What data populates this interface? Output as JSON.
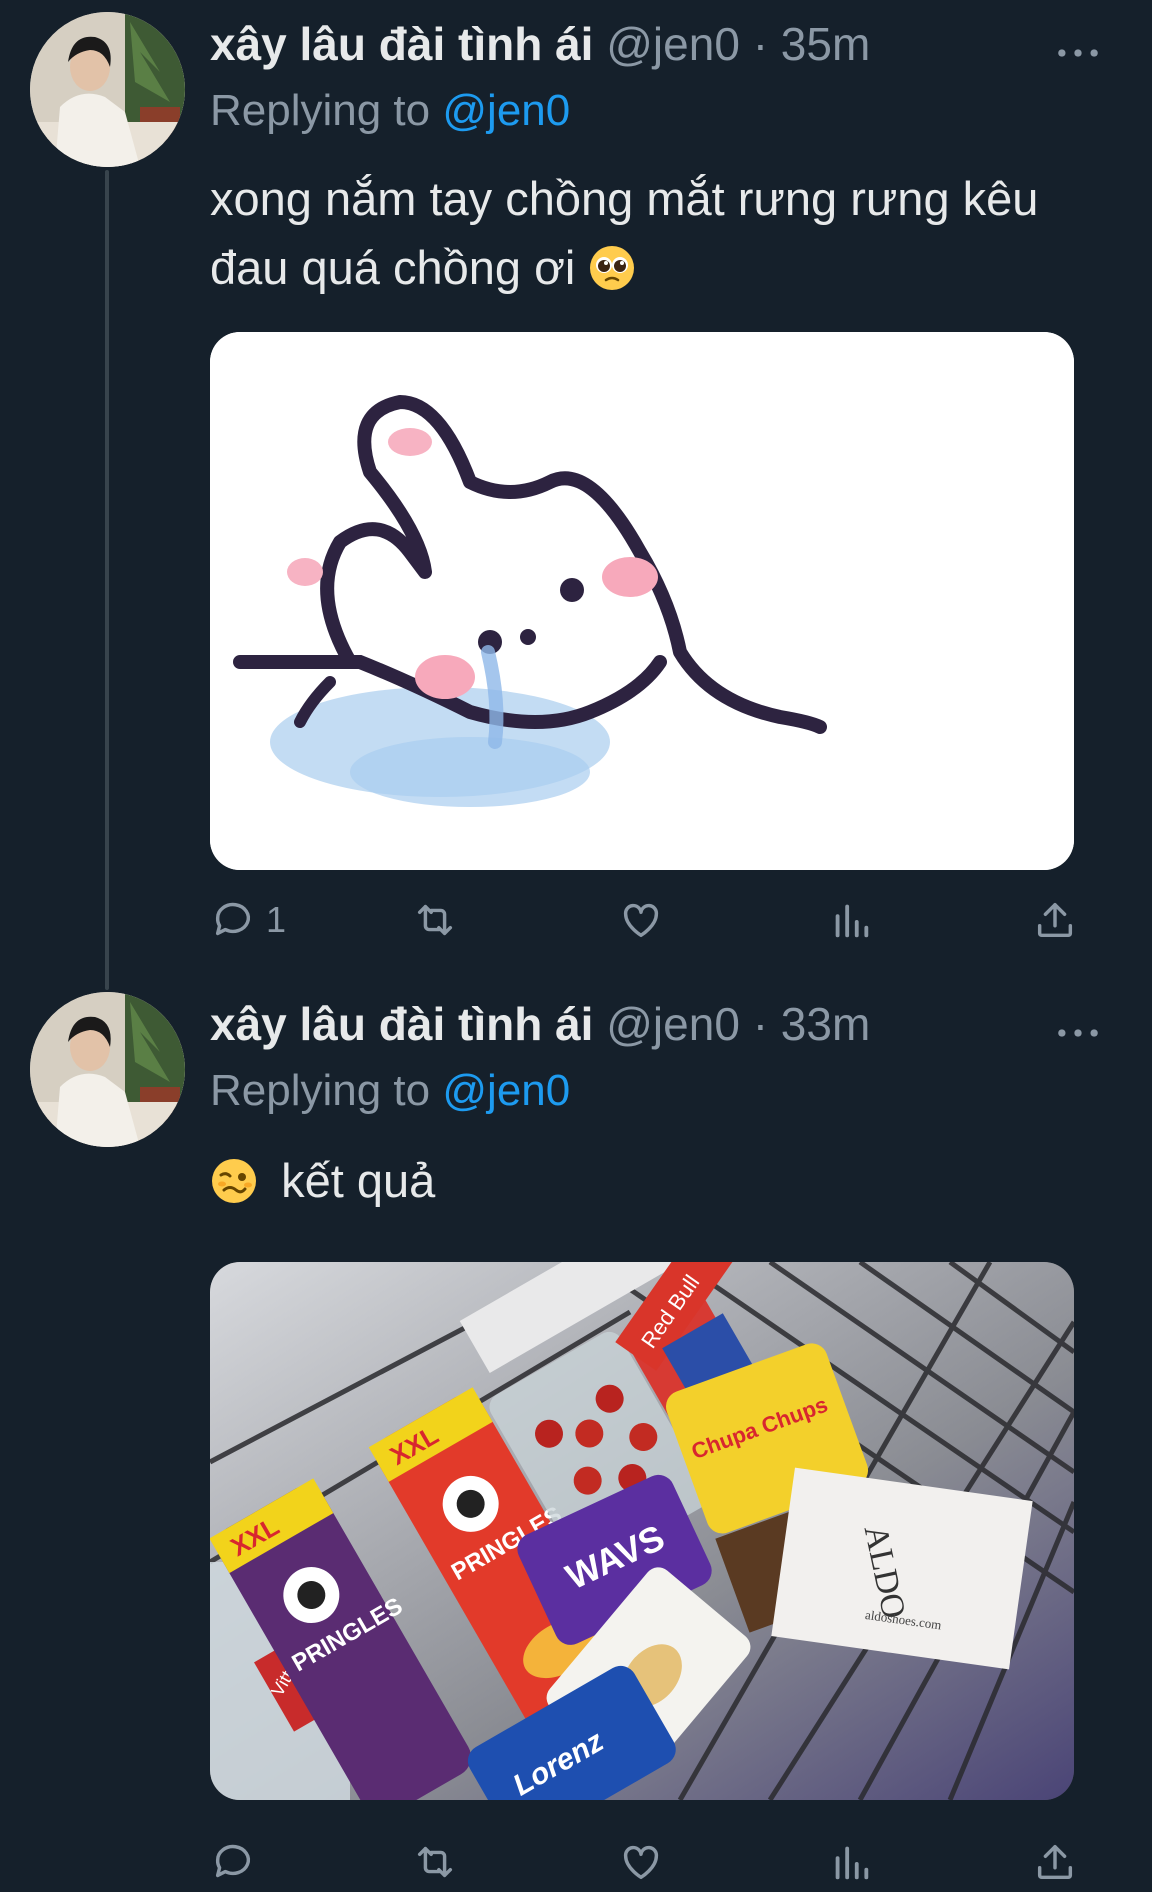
{
  "tweets": [
    {
      "display_name": "xây lâu đài tình ái",
      "handle": "@jen0",
      "separator": "·",
      "time": "35m",
      "replying_prefix": "Replying to",
      "replying_handle": "@jen0",
      "text_line1": "xong nắm tay chồng mắt rưng rưng kêu",
      "text_line2": "đau quá chồng ơi",
      "emoji": "pleading-face-emoji",
      "media": "crying-bunny-sticker",
      "reply_count": "1"
    },
    {
      "display_name": "xây lâu đài tình ái",
      "handle": "@jen0",
      "separator": "·",
      "time": "33m",
      "replying_prefix": "Replying to",
      "replying_handle": "@jen0",
      "emoji": "woozy-face-emoji",
      "text": "kết quả",
      "media": "shopping-cart-photo",
      "media_texts": {
        "pringles": "PRINGLES",
        "xxl": "XXL",
        "aldo": "ALDO",
        "aldo_url": "aldoshoes.com",
        "lorenz": "Lorenz",
        "redbull": "Red Bull",
        "wavs": "WAVS",
        "chupa": "Chupa Chups"
      },
      "reply_count": ""
    }
  ],
  "colors": {
    "background": "#15202b",
    "text": "#e7e9ea",
    "secondary": "#8b98a5",
    "accent": "#1d9bf0",
    "thread_line": "#38444d"
  },
  "icons": [
    "reply-icon",
    "retweet-icon",
    "like-icon",
    "views-icon",
    "share-icon",
    "more-icon"
  ]
}
